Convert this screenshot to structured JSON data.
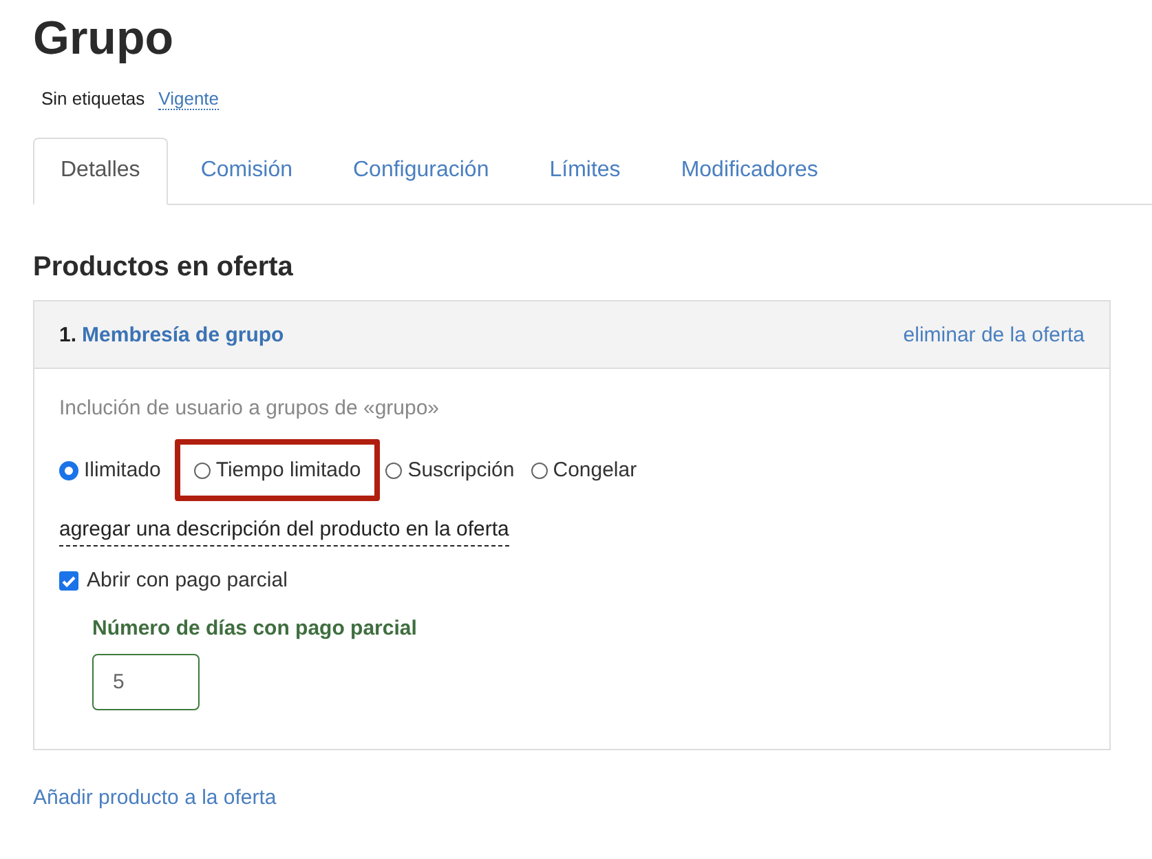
{
  "title": "Grupo",
  "tags": {
    "label": "Sin etiquetas",
    "status": "Vigente"
  },
  "tabs": [
    {
      "label": "Detalles",
      "selected": true
    },
    {
      "label": "Comisión",
      "selected": false
    },
    {
      "label": "Configuración",
      "selected": false
    },
    {
      "label": "Límites",
      "selected": false
    },
    {
      "label": "Modificadores",
      "selected": false
    }
  ],
  "section_title": "Productos en oferta",
  "products": [
    {
      "number": "1.",
      "name": "Membresía de grupo",
      "remove": "eliminar de la oferta",
      "description": "Inclución de usuario a grupos de «grupo»",
      "options": [
        {
          "label": "Ilimitado",
          "selected": true,
          "highlighted": false
        },
        {
          "label": "Tiempo limitado",
          "selected": false,
          "highlighted": true
        },
        {
          "label": "Suscripción",
          "selected": false,
          "highlighted": false
        },
        {
          "label": "Congelar",
          "selected": false,
          "highlighted": false
        }
      ],
      "add_description": "agregar una descripción del producto en la oferta",
      "partial_payment": {
        "label": "Abrir con pago parcial",
        "checked": true
      },
      "days_field": {
        "label": "Número de días con pago parcial",
        "value": "5"
      }
    }
  ],
  "add_product": "Añadir producto a la oferta"
}
